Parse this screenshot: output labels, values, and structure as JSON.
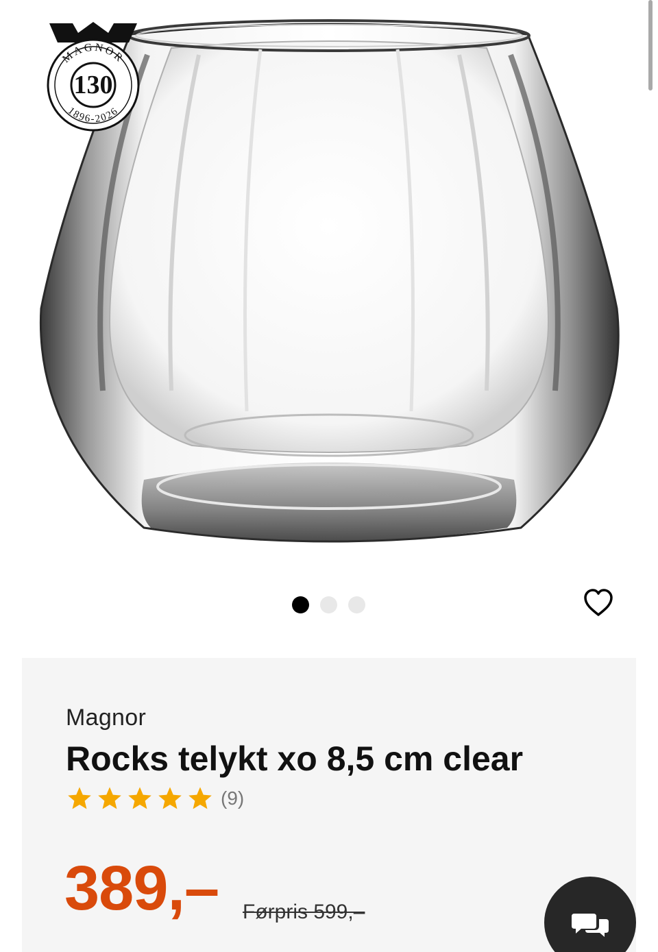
{
  "badge": {
    "top_text": "MAGNOR",
    "number": "130",
    "years": "1896-2026"
  },
  "carousel": {
    "slide_count": 3,
    "active_index": 0
  },
  "product": {
    "brand": "Magnor",
    "title": "Rocks telykt xo 8,5 cm clear",
    "rating": {
      "stars_filled": 5,
      "stars_total": 5,
      "review_count": "(9)",
      "star_color": "#f5a700"
    },
    "price": "389,–",
    "old_price": "Førpris 599,–",
    "price_color": "#d94a0b"
  },
  "icons": {
    "favorite": "heart-outline-icon",
    "chat": "chat-bubbles-icon"
  }
}
